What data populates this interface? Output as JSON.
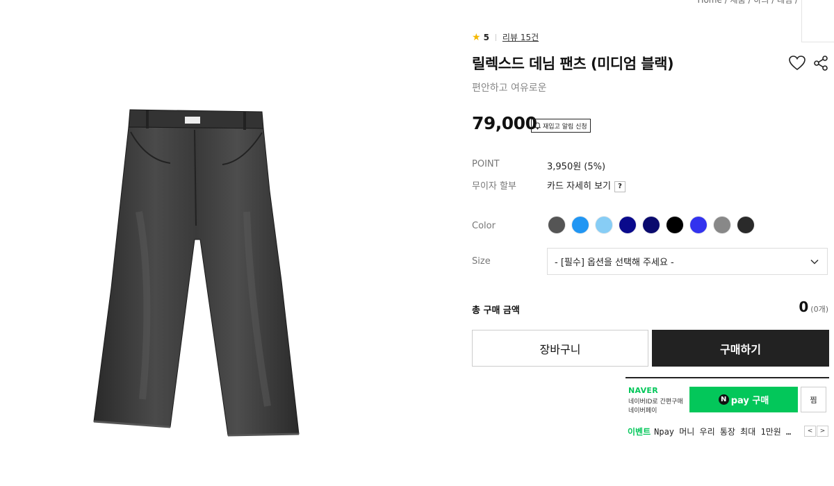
{
  "breadcrumb": "Home / 제품 / 하의 / 데님 / ",
  "rating": {
    "score": "5",
    "reviews": "리뷰 15건"
  },
  "product": {
    "title": "릴렉스드 데님 팬츠 (미디엄 블랙)",
    "subtitle": "편안하고 여유로운",
    "price": "79,000",
    "restock_label": "재입고 알림 신청"
  },
  "info": {
    "point_label": "POINT",
    "point_value": "3,950원 (5%)",
    "installment_label": "무이자 할부",
    "installment_value": "카드 자세히 보기",
    "installment_help": "?"
  },
  "options": {
    "color_label": "Color",
    "colors": [
      "#555555",
      "#2196f3",
      "#87cdf5",
      "#0a0a8c",
      "#0a0a6e",
      "#000000",
      "#3333ee",
      "#888888",
      "#2a2a2a"
    ],
    "size_label": "Size",
    "size_placeholder": "- [필수] 옵션을 선택해 주세요 -"
  },
  "total": {
    "label": "총 구매 금액",
    "amount": "0",
    "count": "(0개)"
  },
  "buttons": {
    "cart": "장바구니",
    "buy": "구매하기"
  },
  "naver": {
    "logo": "NAVER",
    "desc_line1": "네이버ID로 간편구매",
    "desc_line2": "네이버페이",
    "pay_n": "N",
    "pay_label": "pay 구매",
    "zzim": "찜",
    "event_tag": "이벤트",
    "event_text": "Npay 머니 우리 통장 최대 1만원 …",
    "prev": "<",
    "next": ">"
  },
  "icons": {
    "heart": "heart-icon",
    "share": "share-icon",
    "bell": "bell-icon",
    "chevron": "chevron-down-icon",
    "star": "star-icon"
  }
}
